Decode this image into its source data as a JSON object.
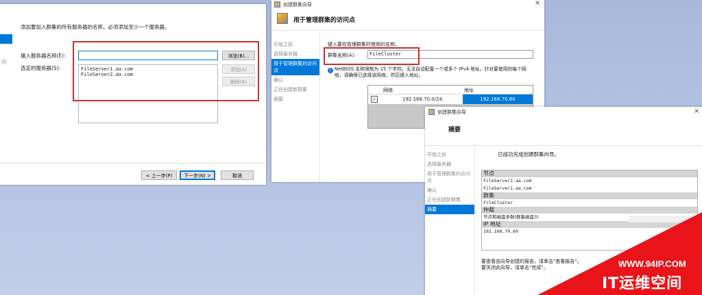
{
  "win1": {
    "instruction": "添加要加入群集的所有服务器的名称。必须添加至少一个服务器。",
    "left_frag": "问",
    "server_name_label": "输入服务器名称(E):",
    "selected_label": "选定的服务器(S):",
    "servers": [
      "FileServer1.aa.com",
      "FileServer2.aa.com"
    ],
    "browse_btn": "浏览(B)...",
    "add_btn": "添加(A)",
    "remove_btn": "删除(R)",
    "prev_btn": "< 上一步(P)",
    "next_btn": "下一步(N) >",
    "cancel_btn": "取消"
  },
  "win2": {
    "title": "创建群集向导",
    "heading": "用于管理群集的访问点",
    "nav": [
      "开始之前",
      "选择服务器",
      "用于管理群集的访问点",
      "确认",
      "正在创建新群集",
      "摘要"
    ],
    "nav_selected": 2,
    "prompt": "键入要在管理群集时使用的名称。",
    "cluster_name_label": "群集名称(A):",
    "cluster_name_value": "FileCluster",
    "info_text": "NetBIOS 名称限制为 15 个字符。无法自动配置一个或多个 IPv4 地址。针对要使用的每个网络，请确保已选择该网络，然后键入地址。",
    "table": {
      "col_network": "网络",
      "col_address": "地址",
      "rows": [
        {
          "network": "192.168.70.0/24",
          "address": "192.168.70.60"
        }
      ]
    },
    "close": "×"
  },
  "win3": {
    "title": "创建群集向导",
    "heading": "摘要",
    "nav": [
      "开始之前",
      "选择服务器",
      "用于管理群集的访问点",
      "确认",
      "正在创建新群集",
      "摘要"
    ],
    "nav_selected": 5,
    "success_text": "已成功完成创建群集向导。",
    "sections": [
      {
        "header": "节点",
        "lines": [
          "FileServer2.aa.com",
          "FileServer1.aa.com"
        ]
      },
      {
        "header": "群集",
        "lines": [
          "FileCluster"
        ]
      },
      {
        "header": "仲裁",
        "lines": [
          "节点和磁盘多数(群集磁盘3)"
        ]
      },
      {
        "header": "IP 地址",
        "lines": [
          "192.168.70.60"
        ]
      }
    ],
    "report_text1": "要查看由向导创建的报告，请单击\"查看报告\"。",
    "report_text2": "要关闭此向导，请单击\"完成\"。",
    "close": "×"
  },
  "watermark": {
    "url": "WWW.94IP.COM",
    "brand": "IT运维空间"
  },
  "colors": {
    "accent": "#0078d7",
    "highlight_red": "#c9302c",
    "watermark_red": "#e8141a",
    "background": "#b0c0e0"
  }
}
